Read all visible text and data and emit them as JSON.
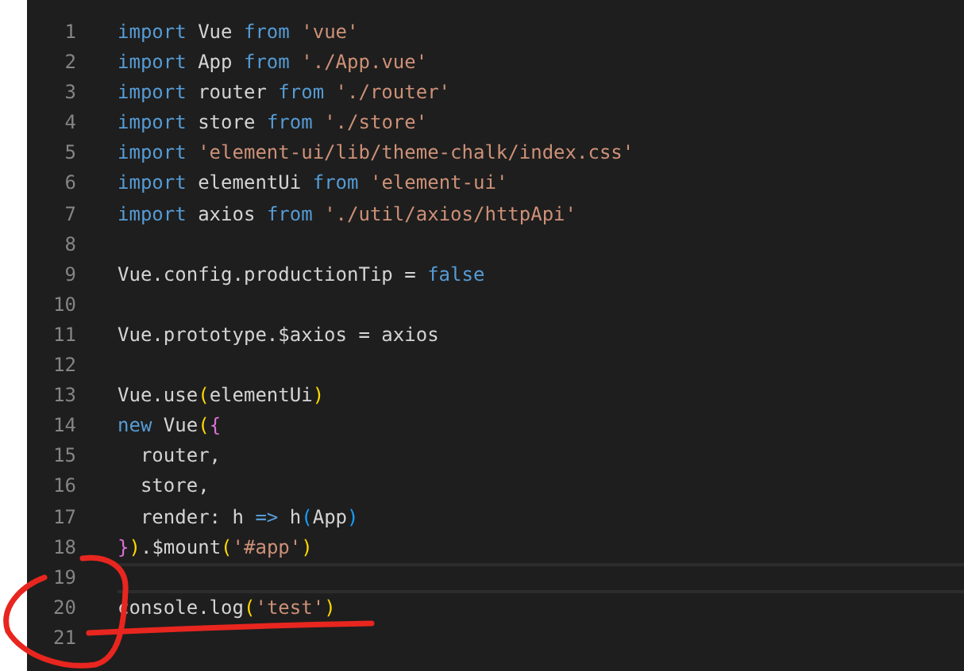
{
  "editor": {
    "lines": [
      {
        "number": "1",
        "current": false,
        "tokens": [
          {
            "kind": "keyword",
            "text": "import"
          },
          {
            "kind": "plain",
            "text": " Vue "
          },
          {
            "kind": "keyword",
            "text": "from"
          },
          {
            "kind": "string",
            "text": " 'vue'"
          }
        ]
      },
      {
        "number": "2",
        "current": false,
        "tokens": [
          {
            "kind": "keyword",
            "text": "import"
          },
          {
            "kind": "plain",
            "text": " App "
          },
          {
            "kind": "keyword",
            "text": "from"
          },
          {
            "kind": "string",
            "text": " './App.vue'"
          }
        ]
      },
      {
        "number": "3",
        "current": false,
        "tokens": [
          {
            "kind": "keyword",
            "text": "import"
          },
          {
            "kind": "plain",
            "text": " router "
          },
          {
            "kind": "keyword",
            "text": "from"
          },
          {
            "kind": "string",
            "text": " './router'"
          }
        ]
      },
      {
        "number": "4",
        "current": false,
        "tokens": [
          {
            "kind": "keyword",
            "text": "import"
          },
          {
            "kind": "plain",
            "text": " store "
          },
          {
            "kind": "keyword",
            "text": "from"
          },
          {
            "kind": "string",
            "text": " './store'"
          }
        ]
      },
      {
        "number": "5",
        "current": false,
        "tokens": [
          {
            "kind": "keyword",
            "text": "import"
          },
          {
            "kind": "string",
            "text": " 'element-ui/lib/theme-chalk/index.css'"
          }
        ]
      },
      {
        "number": "6",
        "current": false,
        "tokens": [
          {
            "kind": "keyword",
            "text": "import"
          },
          {
            "kind": "plain",
            "text": " elementUi "
          },
          {
            "kind": "keyword",
            "text": "from"
          },
          {
            "kind": "string",
            "text": " 'element-ui'"
          }
        ]
      },
      {
        "number": "7",
        "current": false,
        "tokens": [
          {
            "kind": "keyword",
            "text": "import"
          },
          {
            "kind": "plain",
            "text": " axios "
          },
          {
            "kind": "keyword",
            "text": "from"
          },
          {
            "kind": "string",
            "text": " './util/axios/httpApi'"
          }
        ]
      },
      {
        "number": "8",
        "current": false
      },
      {
        "number": "9",
        "current": false,
        "tokens": [
          {
            "kind": "plain",
            "text": "Vue.config.productionTip = "
          },
          {
            "kind": "keyword",
            "text": "false"
          }
        ]
      },
      {
        "number": "10",
        "current": false
      },
      {
        "number": "11",
        "current": false,
        "tokens": [
          {
            "kind": "plain",
            "text": "Vue.prototype.$axios = axios"
          }
        ]
      },
      {
        "number": "12",
        "current": false
      },
      {
        "number": "13",
        "current": false,
        "tokens": [
          {
            "kind": "plain",
            "text": "Vue.use"
          },
          {
            "kind": "bracket1",
            "text": "("
          },
          {
            "kind": "plain",
            "text": "elementUi"
          },
          {
            "kind": "bracket1",
            "text": ")"
          }
        ]
      },
      {
        "number": "14",
        "current": false,
        "tokens": [
          {
            "kind": "keyword",
            "text": "new"
          },
          {
            "kind": "plain",
            "text": " Vue"
          },
          {
            "kind": "bracket1",
            "text": "("
          },
          {
            "kind": "bracket2",
            "text": "{"
          }
        ]
      },
      {
        "number": "15",
        "current": false,
        "tokens": [
          {
            "kind": "plain",
            "text": "  router,"
          }
        ]
      },
      {
        "number": "16",
        "current": false,
        "tokens": [
          {
            "kind": "plain",
            "text": "  store,"
          }
        ]
      },
      {
        "number": "17",
        "current": false,
        "tokens": [
          {
            "kind": "plain",
            "text": "  render: h "
          },
          {
            "kind": "keyword",
            "text": "=>"
          },
          {
            "kind": "plain",
            "text": " h"
          },
          {
            "kind": "bracket3",
            "text": "("
          },
          {
            "kind": "plain",
            "text": "App"
          },
          {
            "kind": "bracket3",
            "text": ")"
          }
        ]
      },
      {
        "number": "18",
        "current": false,
        "tokens": [
          {
            "kind": "bracket2",
            "text": "}"
          },
          {
            "kind": "bracket1",
            "text": ")"
          },
          {
            "kind": "plain",
            "text": ".$mount"
          },
          {
            "kind": "bracket1",
            "text": "("
          },
          {
            "kind": "string",
            "text": "'#app'"
          },
          {
            "kind": "bracket1",
            "text": ")"
          }
        ]
      },
      {
        "number": "19",
        "current": true
      },
      {
        "number": "20",
        "current": false,
        "tokens": [
          {
            "kind": "plain",
            "text": "console.log"
          },
          {
            "kind": "bracket1",
            "text": "("
          },
          {
            "kind": "string",
            "text": "'test'"
          },
          {
            "kind": "bracket1",
            "text": ")"
          }
        ]
      },
      {
        "number": "21",
        "current": false
      }
    ]
  }
}
